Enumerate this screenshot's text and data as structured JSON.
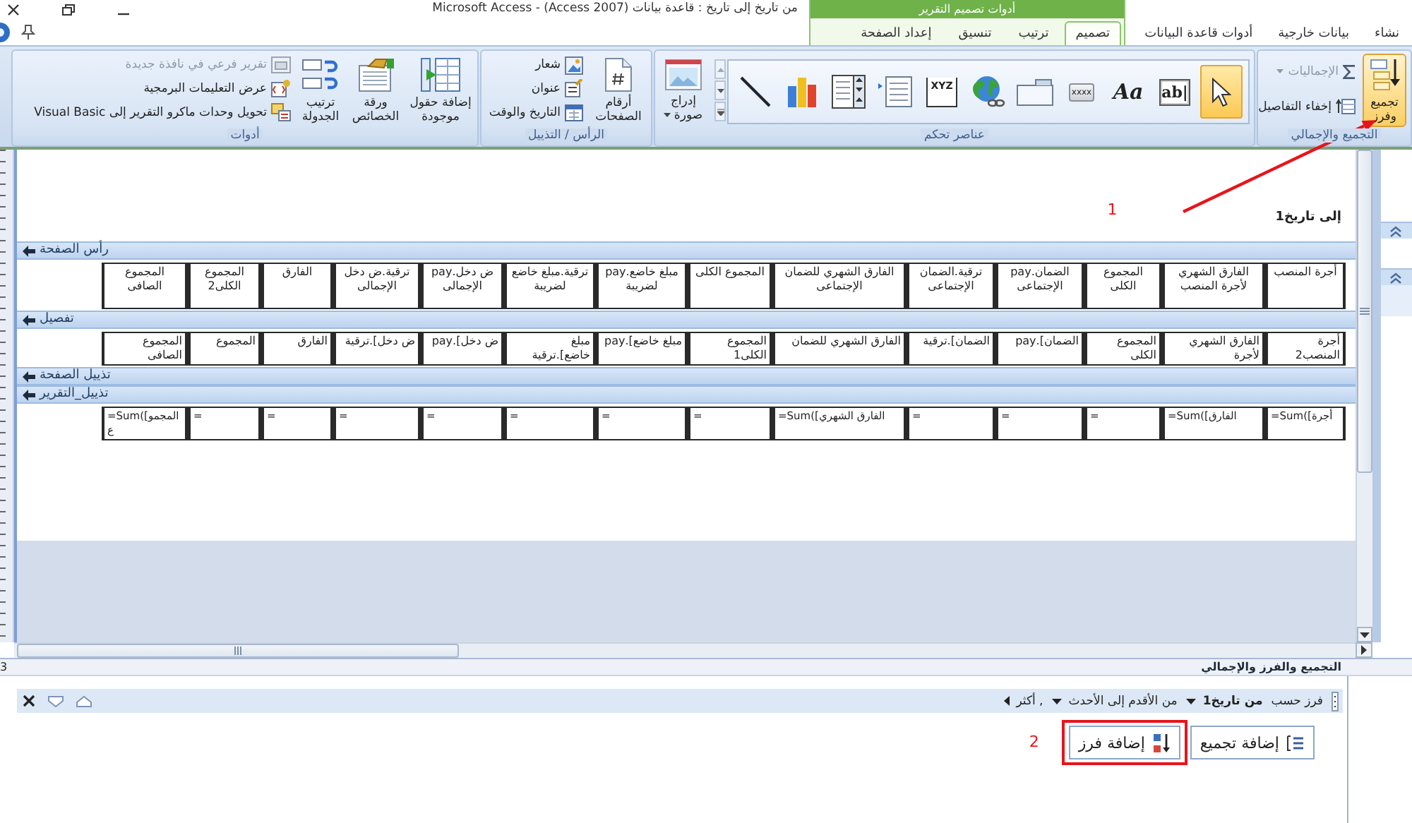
{
  "window": {
    "title": "من تاريخ إلى تاريخ : قاعدة بيانات (Access 2007) - Microsoft Access"
  },
  "tabs": [
    {
      "label": "نشاء",
      "selected": false
    },
    {
      "label": "بيانات خارجية",
      "selected": false
    },
    {
      "label": "أدوات قاعدة البيانات",
      "selected": false
    }
  ],
  "contextual_tabs": {
    "label": "أدوات تصميم التقرير",
    "tabs": [
      {
        "label": "تصميم",
        "selected": true
      },
      {
        "label": "ترتيب",
        "selected": false
      },
      {
        "label": "تنسيق",
        "selected": false
      },
      {
        "label": "إعداد الصفحة",
        "selected": false
      }
    ]
  },
  "ribbon": {
    "groups": [
      {
        "label": "التجميع والإجمالي",
        "items": [
          {
            "kind": "large",
            "label": "تجميع وفرز",
            "highlighted": true
          },
          {
            "kind": "stack",
            "buttons": [
              {
                "label": "الإجماليات",
                "disabled": true,
                "dropdown": true
              },
              {
                "label": "إخفاء التفاصيل",
                "disabled": false
              }
            ]
          }
        ]
      },
      {
        "label": "عناصر تحكم",
        "items": [
          {
            "kind": "gallery",
            "tools": [
              {
                "selected": true
              },
              {
                "glyph": "ab|",
                "selected": false
              },
              {
                "glyph": "Aa",
                "selected": false
              },
              {
                "glyph": "xxxx",
                "selected": false
              },
              {
                "selected": false
              },
              {
                "selected": false
              },
              {
                "glyph": "XYZ",
                "selected": false
              },
              {
                "selected": false
              },
              {
                "selected": false
              },
              {
                "selected": false
              },
              {
                "selected": false
              }
            ]
          },
          {
            "kind": "large",
            "label": "إدراج صورة",
            "dropdown": true,
            "highlighted": false
          }
        ]
      },
      {
        "label": "الرأس / التذييل",
        "items": [
          {
            "kind": "large",
            "label": "أرقام الصفحات",
            "highlighted": false
          },
          {
            "kind": "stack",
            "buttons": [
              {
                "label": "شعار",
                "disabled": false
              },
              {
                "label": "عنوان",
                "disabled": false
              },
              {
                "label": "التاريخ والوقت",
                "disabled": false
              }
            ]
          }
        ]
      },
      {
        "label": "أدوات",
        "items": [
          {
            "kind": "large",
            "label": "إضافة حقول موجودة",
            "highlighted": false
          },
          {
            "kind": "large",
            "label": "ورقة الخصائص",
            "highlighted": false
          },
          {
            "kind": "large",
            "label": "ترتيب الجدولة",
            "highlighted": false
          },
          {
            "kind": "stack",
            "buttons": [
              {
                "label": "تقرير فرعي في نافذة جديدة",
                "disabled": true
              },
              {
                "label": "عرض التعليمات البرمجية",
                "disabled": false
              },
              {
                "label": "تحويل وحدات ماكرو التقرير إلى Visual Basic",
                "disabled": false
              }
            ]
          }
        ]
      }
    ]
  },
  "report_design": {
    "report_header": {
      "text": "إلى تاريخ1"
    },
    "sections": [
      {
        "title": "رأس الصفحة",
        "kind": "labels",
        "cells": [
          "أجرة المنصب",
          "الفارق الشهري لأجرة المنصب",
          "المجموع الكلى",
          "الضمان.pay الإجتماعى",
          "ترقية.الضمان الإجتماعى",
          "الفارق الشهري للضمان الإجتماعى",
          "المجموع الكلى",
          "مبلغ خاضع.pay لضريبة",
          "ترقية.مبلغ خاضع لضريبة",
          "ض دخل.pay الإجمالى",
          "ترقية.ض دخل الإجمالى",
          "الفارق",
          "المجموع الكلى2",
          "المجموع الصافى"
        ]
      },
      {
        "title": "تفصيل",
        "kind": "fields",
        "cells": [
          "أجرة المنصب2",
          "الفارق الشهري لأجرة",
          "المجموع الكلى",
          "الضمان].pay",
          "الضمان].ترقية",
          "الفارق الشهري للضمان",
          "المجموع الكلى1",
          "مبلغ خاضع].pay",
          "مبلغ خاضع].ترقية",
          "ض دخل].pay",
          "ض دخل].ترقية",
          "الفارق",
          "المجموع",
          "المجموع الصافى"
        ]
      },
      {
        "title": "تذييل الصفحة"
      },
      {
        "title": "تذييل_التقرير",
        "kind": "expressions",
        "cells": [
          "=Sum([أجرة",
          "=Sum([الفارق",
          "=",
          "=",
          "=",
          "=Sum([الفارق الشهري",
          "=",
          "=",
          "=",
          "=",
          "=",
          "=",
          "=",
          "=Sum([المجموع"
        ]
      }
    ]
  },
  "edge_label": "3",
  "group_sort_pane": {
    "title": "التجميع والفرز والإجمالي",
    "sort_rows": [
      {
        "label": "فرز حسب",
        "field": "من تاريخ1",
        "order": "من الأقدم إلى الأحدث",
        "more": ", أكثر"
      }
    ],
    "buttons": [
      {
        "label": "إضافة تجميع",
        "highlighted": false
      },
      {
        "label": "إضافة فرز",
        "highlighted": true
      }
    ]
  },
  "annotations": [
    {
      "label": "1"
    },
    {
      "label": "2"
    }
  ]
}
